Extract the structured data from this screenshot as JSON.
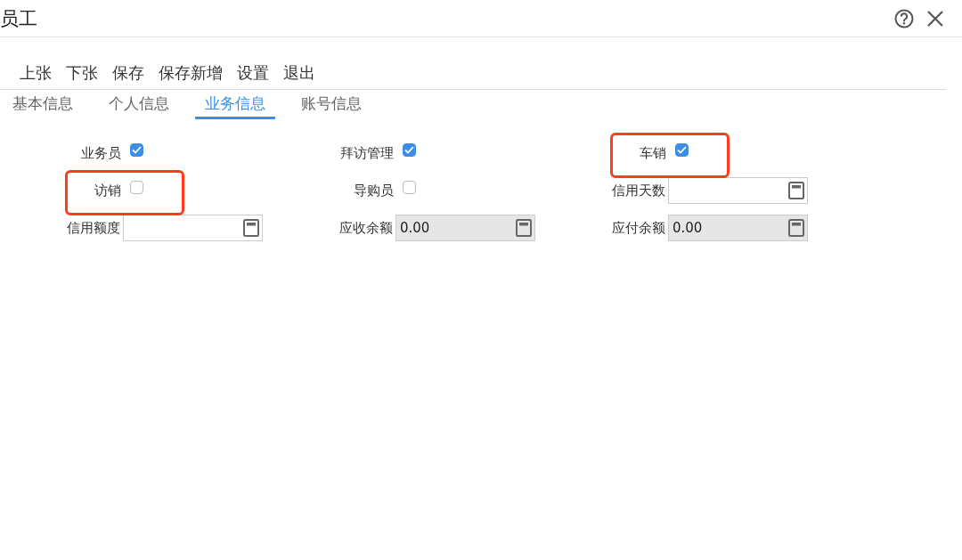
{
  "window": {
    "title": "员工"
  },
  "toolbar": [
    "上张",
    "下张",
    "保存",
    "保存新增",
    "设置",
    "退出"
  ],
  "tabs": [
    {
      "label": "基本信息",
      "selected": false
    },
    {
      "label": "个人信息",
      "selected": false
    },
    {
      "label": "业务信息",
      "selected": true
    },
    {
      "label": "账号信息",
      "selected": false
    }
  ],
  "fields": [
    {
      "kind": "checkbox",
      "label": "业务员",
      "checked": true,
      "highlighted": false
    },
    {
      "kind": "checkbox",
      "label": "拜访管理",
      "checked": true,
      "highlighted": false
    },
    {
      "kind": "checkbox",
      "label": "车销",
      "checked": true,
      "highlighted": true
    },
    {
      "kind": "checkbox",
      "label": "访销",
      "checked": false,
      "highlighted": true
    },
    {
      "kind": "checkbox",
      "label": "导购员",
      "checked": false,
      "highlighted": false
    },
    {
      "kind": "number",
      "label": "信用天数",
      "disabled": false
    },
    {
      "kind": "number",
      "label": "信用额度",
      "disabled": false
    },
    {
      "kind": "number",
      "label": "应收余额",
      "value": "0.00",
      "disabled": true
    },
    {
      "kind": "number",
      "label": "应付余额",
      "value": "0.00",
      "disabled": true
    }
  ]
}
